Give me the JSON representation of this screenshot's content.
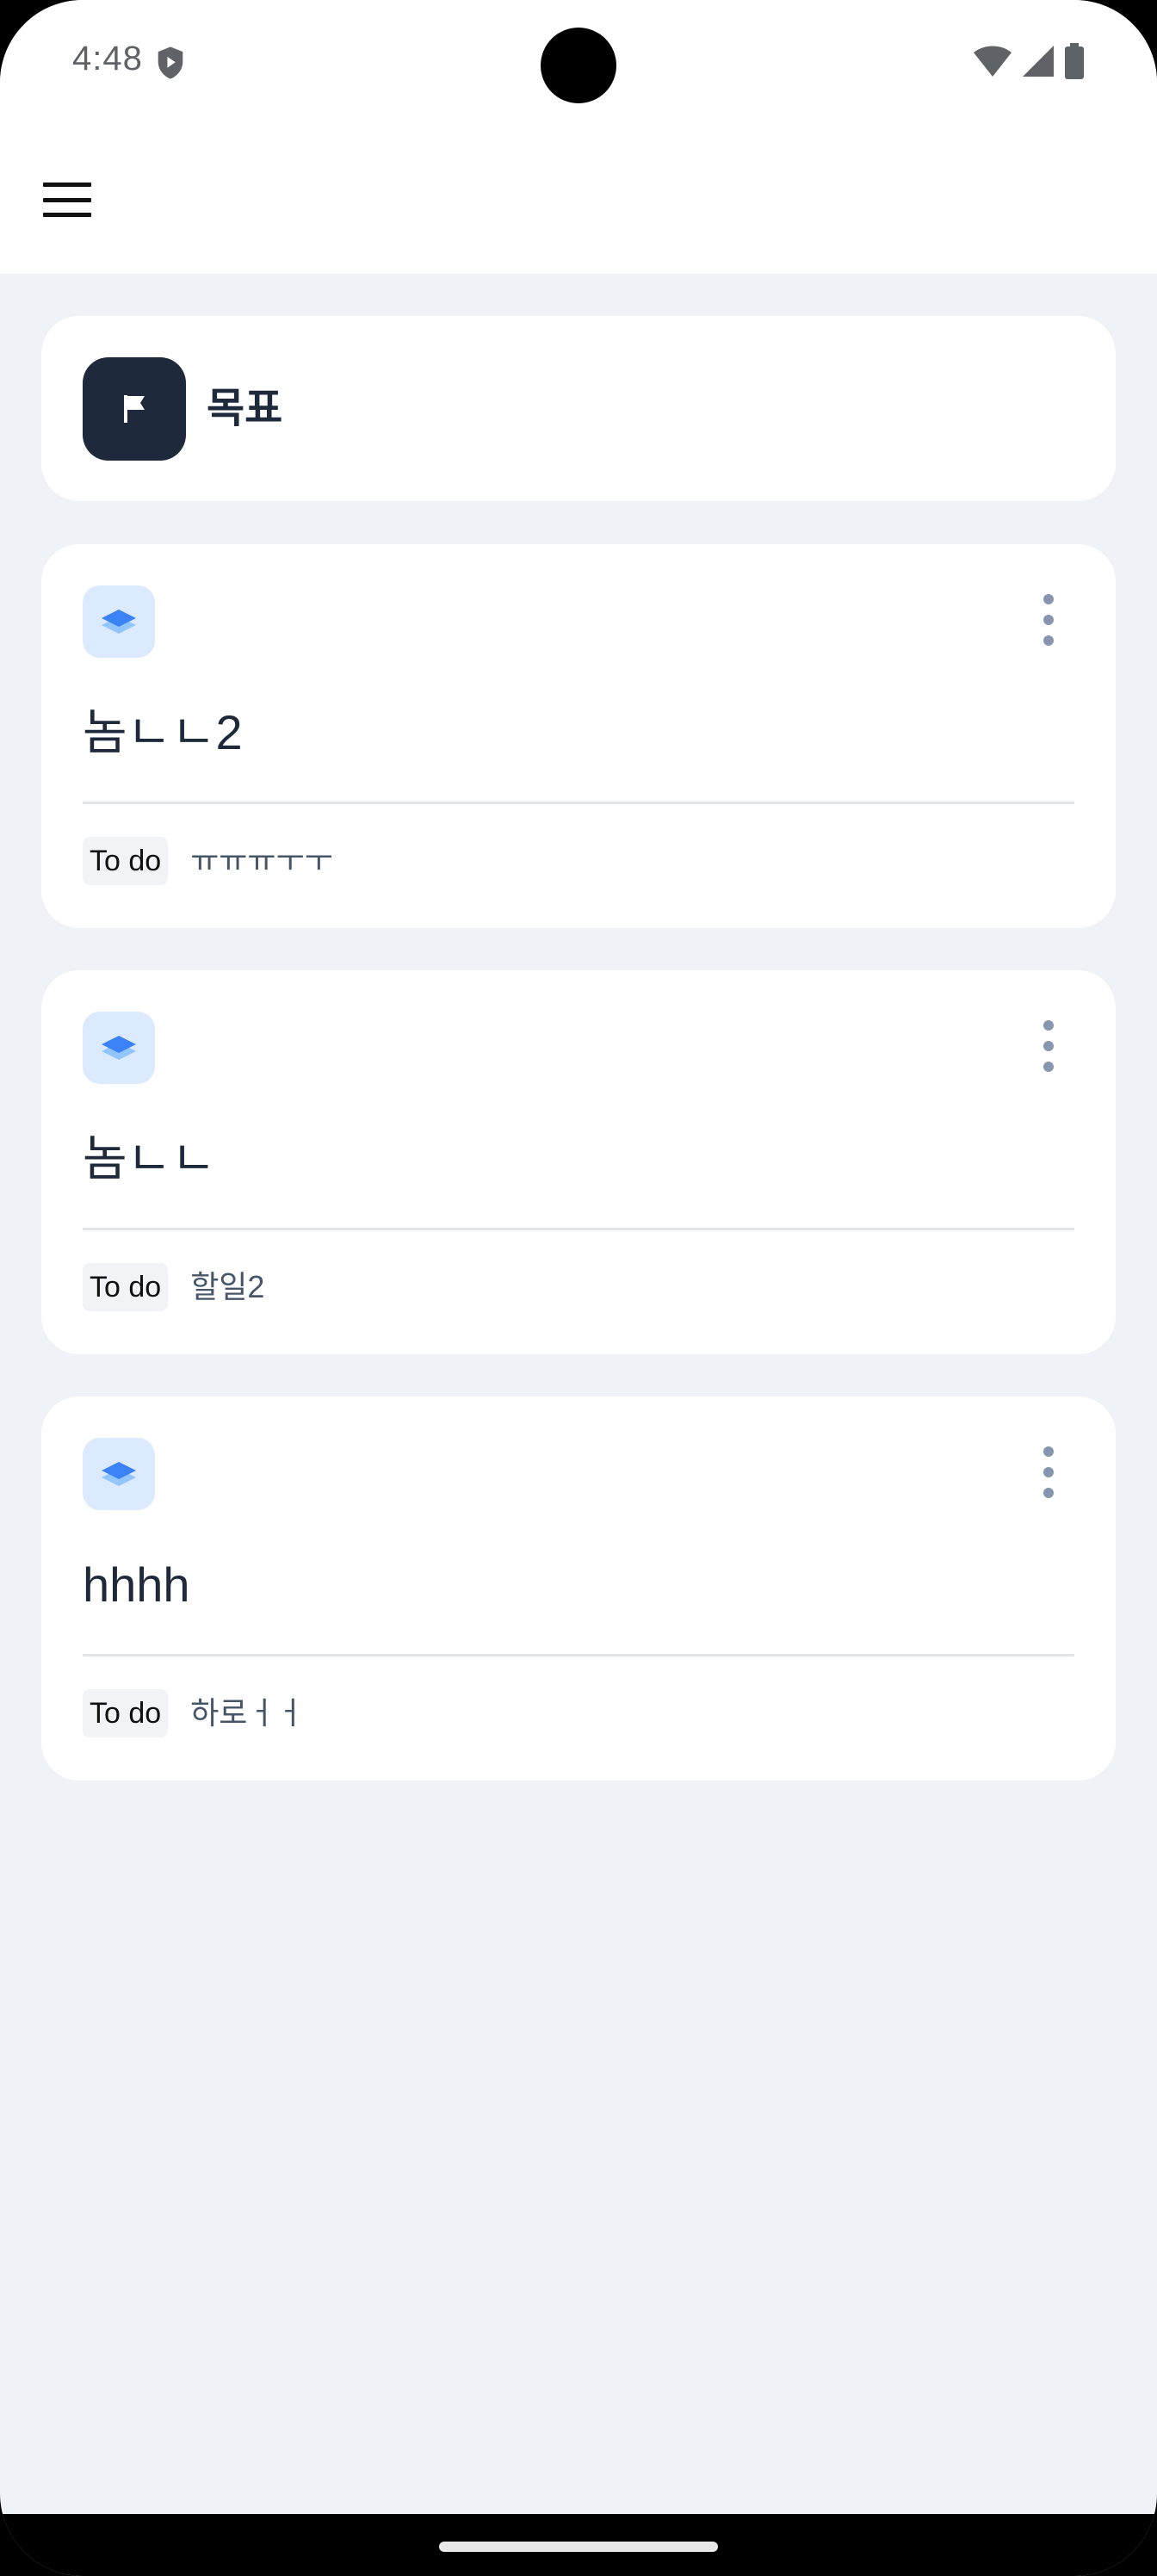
{
  "status_bar": {
    "time": "4:48"
  },
  "app_bar": {
    "menu_icon": "hamburger-menu-icon"
  },
  "goal": {
    "title": "목표",
    "icon": "flag-icon"
  },
  "items": [
    {
      "title": "놈ㄴㄴ2",
      "todo_label": "To do",
      "todo_text": "ㅠㅠㅠㅜㅜ"
    },
    {
      "title": "놈ㄴㄴ",
      "todo_label": "To do",
      "todo_text": "할일2"
    },
    {
      "title": "hhhh",
      "todo_label": "To do",
      "todo_text": "하로ㅓㅓ"
    }
  ],
  "colors": {
    "background": "#eff2f7",
    "card": "#ffffff",
    "goal_icon_bg": "#1e293b",
    "layer_icon_bg": "#dbeafe",
    "layer_icon_fg": "#3b82f6"
  }
}
